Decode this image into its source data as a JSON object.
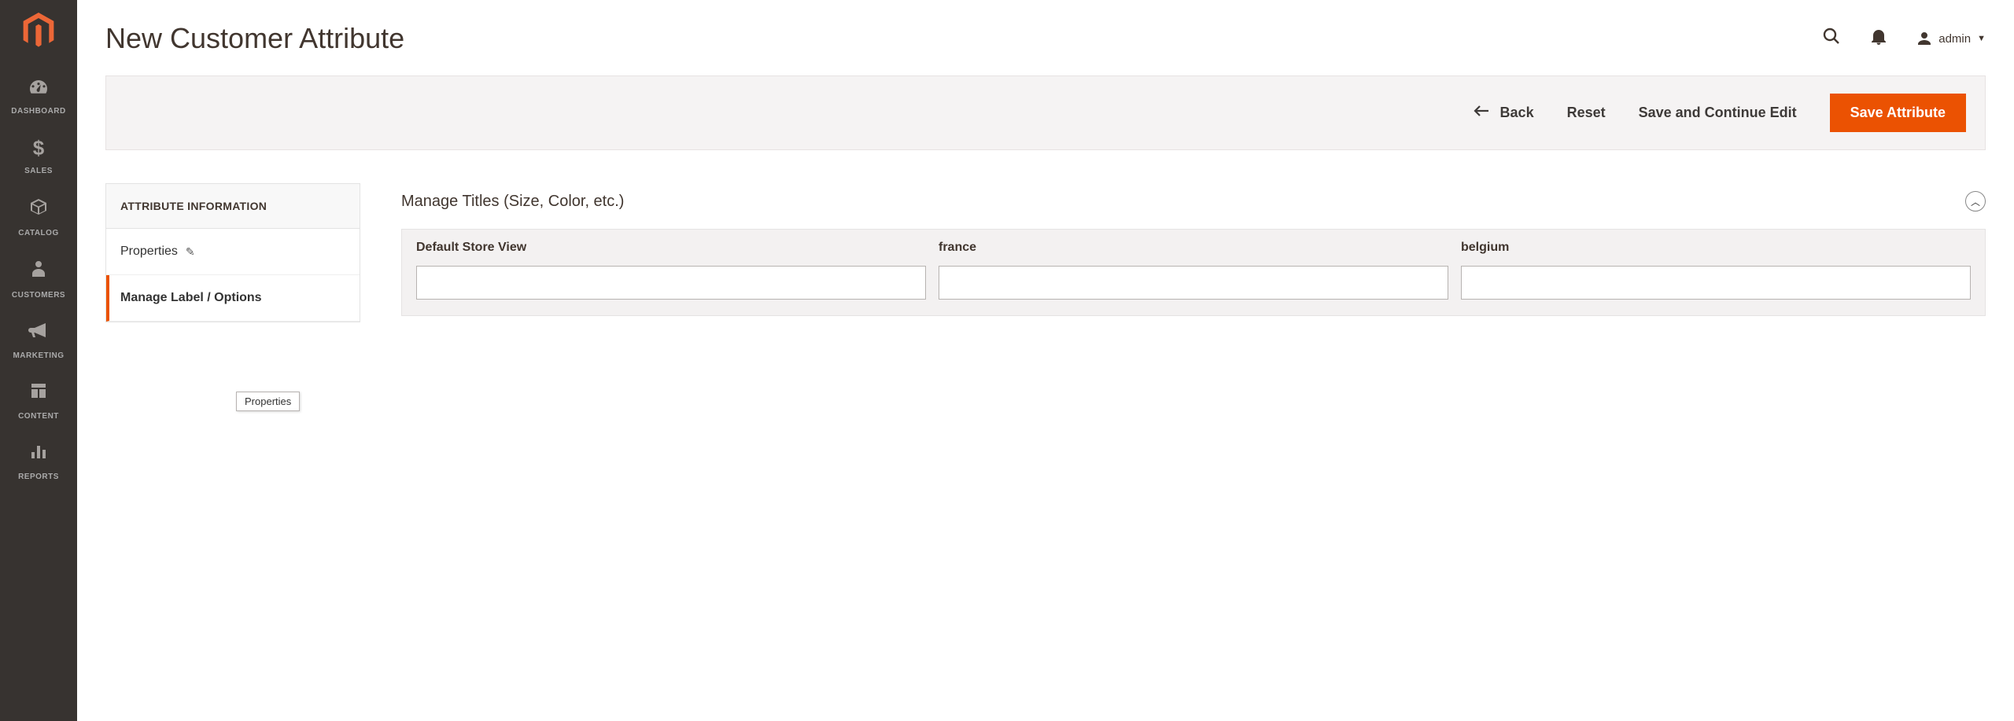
{
  "sidebar": {
    "items": [
      {
        "label": "DASHBOARD"
      },
      {
        "label": "SALES"
      },
      {
        "label": "CATALOG"
      },
      {
        "label": "CUSTOMERS"
      },
      {
        "label": "MARKETING"
      },
      {
        "label": "CONTENT"
      },
      {
        "label": "REPORTS"
      }
    ]
  },
  "header": {
    "title": "New Customer Attribute",
    "user_label": "admin"
  },
  "actions": {
    "back": "Back",
    "reset": "Reset",
    "save_continue": "Save and Continue Edit",
    "save": "Save Attribute"
  },
  "left_panel": {
    "heading": "ATTRIBUTE INFORMATION",
    "tabs": {
      "properties": "Properties",
      "manage": "Manage Label / Options"
    }
  },
  "section": {
    "title": "Manage Titles (Size, Color, etc.)",
    "columns": [
      "Default Store View",
      "france",
      "belgium"
    ],
    "values": [
      "",
      "",
      ""
    ]
  },
  "tooltip": "Properties"
}
